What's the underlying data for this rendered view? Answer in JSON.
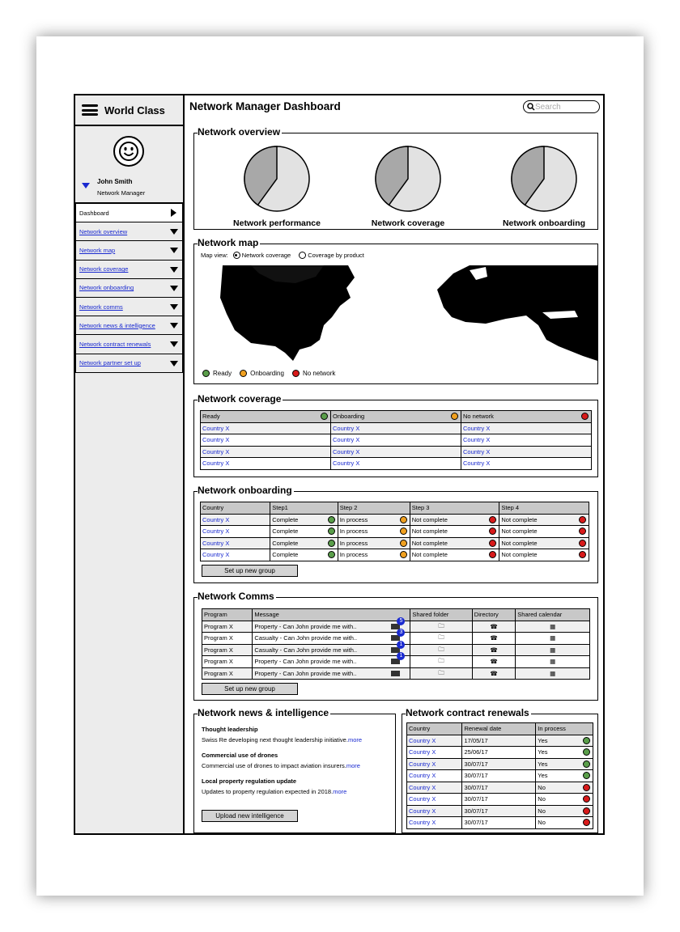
{
  "app": {
    "brand": "World Class",
    "title": "Network Manager Dashboard",
    "search_placeholder": "Search"
  },
  "user": {
    "name": "John Smith",
    "role": "Network Manager"
  },
  "sidebar": {
    "items": [
      {
        "label": "Dashboard"
      },
      {
        "label": "Network overview"
      },
      {
        "label": "Network map"
      },
      {
        "label": "Network coverage"
      },
      {
        "label": "Network onboarding"
      },
      {
        "label": "Network comms"
      },
      {
        "label": "Network news & intelligence"
      },
      {
        "label": "Network contract renewals"
      },
      {
        "label": "Network partner set up"
      }
    ]
  },
  "overview": {
    "title": "Network overview",
    "pies": [
      {
        "label": "Network performance",
        "fraction": 0.4
      },
      {
        "label": "Network coverage",
        "fraction": 0.4
      },
      {
        "label": "Network onboarding",
        "fraction": 0.4
      }
    ]
  },
  "map": {
    "title": "Network map",
    "view_label": "Map view:",
    "option1": "Network coverage",
    "option2": "Coverage by product",
    "legend": [
      "Ready",
      "Onboarding",
      "No network"
    ]
  },
  "colors": {
    "ready": "#5a9e4a",
    "onboarding": "#f0a020",
    "none": "#d81a1a"
  },
  "coverage": {
    "title": "Network coverage",
    "headers": [
      "Ready",
      "Onboarding",
      "No network"
    ],
    "rows": [
      [
        "Country X",
        "Country X",
        "Country X"
      ],
      [
        "Country X",
        "Country X",
        "Country X"
      ],
      [
        "Country X",
        "Country X",
        "Country X"
      ],
      [
        "Country X",
        "Country X",
        "Country X"
      ]
    ]
  },
  "onboarding": {
    "title": "Network onboarding",
    "headers": [
      "Country",
      "Step1",
      "Step 2",
      "Step 3",
      "Step 4"
    ],
    "rows": [
      [
        "Country X",
        "Complete",
        "In process",
        "Not complete",
        "Not complete"
      ],
      [
        "Country X",
        "Complete",
        "In process",
        "Not complete",
        "Not complete"
      ],
      [
        "Country X",
        "Complete",
        "In process",
        "Not complete",
        "Not complete"
      ],
      [
        "Country X",
        "Complete",
        "In process",
        "Not complete",
        "Not complete"
      ]
    ],
    "button": "Set up new group"
  },
  "comms": {
    "title": "Network Comms",
    "headers": [
      "Program",
      "Message",
      "Shared folder",
      "Directory",
      "Shared calendar"
    ],
    "rows": [
      {
        "program": "Program X",
        "message": "Property - Can John provide me with..",
        "badge": "5"
      },
      {
        "program": "Program X",
        "message": "Casualty - Can John provide me with..",
        "badge": "3"
      },
      {
        "program": "Program X",
        "message": "Casualty - Can John provide me with..",
        "badge": "1"
      },
      {
        "program": "Program X",
        "message": "Property - Can John provide me with..",
        "badge": "1"
      },
      {
        "program": "Program X",
        "message": "Property - Can John provide me with..",
        "badge": ""
      }
    ],
    "button": "Set up new group"
  },
  "news": {
    "title": "Network news & intelligence",
    "items": [
      {
        "head": "Thought leadership",
        "text": "Swiss Re developing next thought leadership initiative.",
        "more": "more"
      },
      {
        "head": "Commercial use of drones",
        "text": "Commercial use of drones to impact aviation insurers.",
        "more": "more"
      },
      {
        "head": "Local property regulation update",
        "text": "Updates to property regulation expected in 2018.",
        "more": "more"
      }
    ],
    "button": "Upload new intelligence"
  },
  "renewals": {
    "title": "Network contract renewals",
    "headers": [
      "Country",
      "Renewal date",
      "In process"
    ],
    "rows": [
      [
        "Country X",
        "17/05/17",
        "Yes",
        "g"
      ],
      [
        "Country X",
        "25/06/17",
        "Yes",
        "g"
      ],
      [
        "Country X",
        "30/07/17",
        "Yes",
        "g"
      ],
      [
        "Country X",
        "30/07/17",
        "Yes",
        "g"
      ],
      [
        "Country X",
        "30/07/17",
        "No",
        "r"
      ],
      [
        "Country X",
        "30/07/17",
        "No",
        "r"
      ],
      [
        "Country X",
        "30/07/17",
        "No",
        "r"
      ],
      [
        "Country X",
        "30/07/17",
        "No",
        "r"
      ]
    ]
  }
}
